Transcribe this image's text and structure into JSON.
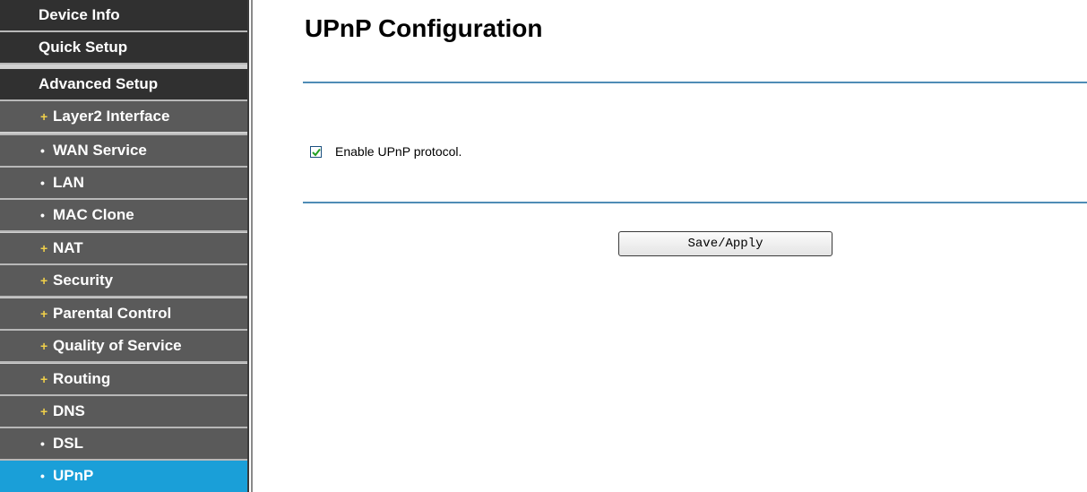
{
  "sidebar": {
    "items": [
      {
        "label": "Device Info",
        "bullet": ""
      },
      {
        "label": "Quick Setup",
        "bullet": ""
      },
      {
        "label": "Advanced Setup",
        "bullet": ""
      },
      {
        "label": "Layer2 Interface",
        "bullet": "+"
      },
      {
        "label": "WAN Service",
        "bullet": "•"
      },
      {
        "label": "LAN",
        "bullet": "•"
      },
      {
        "label": "MAC Clone",
        "bullet": "•"
      },
      {
        "label": "NAT",
        "bullet": "+"
      },
      {
        "label": "Security",
        "bullet": "+"
      },
      {
        "label": "Parental Control",
        "bullet": "+"
      },
      {
        "label": "Quality of Service",
        "bullet": "+"
      },
      {
        "label": "Routing",
        "bullet": "+"
      },
      {
        "label": "DNS",
        "bullet": "+"
      },
      {
        "label": "DSL",
        "bullet": "•"
      },
      {
        "label": "UPnP",
        "bullet": "•"
      }
    ],
    "active": "UPnP"
  },
  "main": {
    "title": "UPnP Configuration",
    "enable_upnp": {
      "label": "Enable UPnP protocol.",
      "checked": true
    },
    "save_label": "Save/Apply"
  },
  "colors": {
    "top_nav_bg": "#303030",
    "sub_nav_bg": "#5a5a5a",
    "active_nav_bg": "#1a9fd8",
    "plus_bullet": "#f0d04a",
    "divider": "#4f8cb6"
  }
}
